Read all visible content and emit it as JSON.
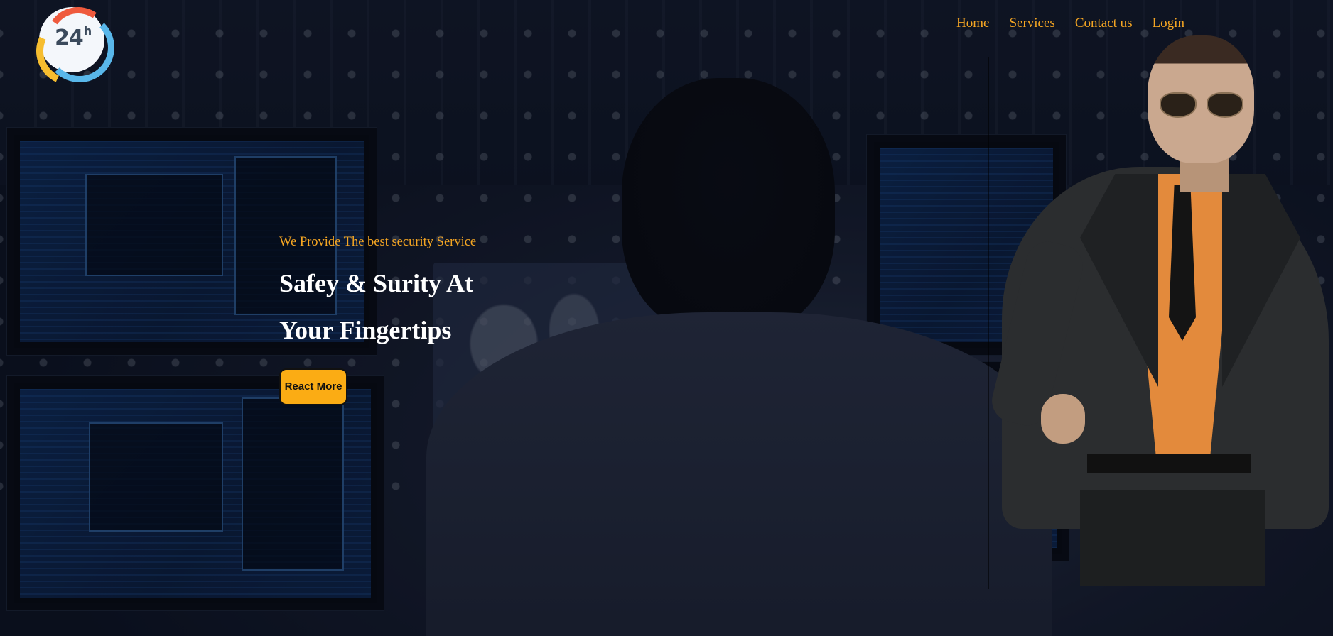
{
  "logo": {
    "text": "24",
    "superscript": "h",
    "colors": {
      "red": "#ef5a3d",
      "blue": "#59b7ea",
      "yellow": "#f6bd2f"
    }
  },
  "nav": {
    "items": [
      {
        "label": "Home"
      },
      {
        "label": "Services"
      },
      {
        "label": "Contact us"
      },
      {
        "label": "Login"
      }
    ]
  },
  "hero": {
    "tagline": "We Provide The best security Service",
    "headline_line1": "Safey & Surity At",
    "headline_line2": "Your Fingertips",
    "cta_label": "React More"
  },
  "colors": {
    "accent": "#f5a623",
    "button": "#fbac14",
    "headline": "#ffffff",
    "background": "#0b1222"
  }
}
